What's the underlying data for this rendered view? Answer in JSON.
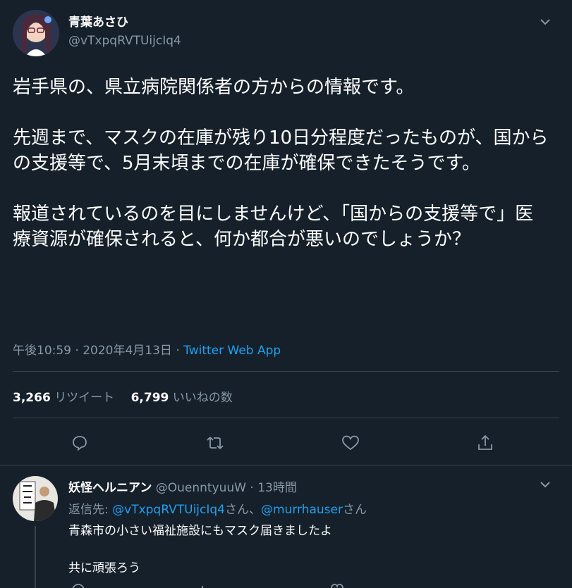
{
  "main_tweet": {
    "author_name": "青葉あさひ",
    "author_handle": "@vTxpqRVTUijcIq4",
    "avatar_icon": "user-avatar-anime-girl",
    "text": "岩手県の、県立病院関係者の方からの情報です。\n\n先週まで、マスクの在庫が残り10日分程度だったものが、国からの支援等で、5月末頃までの在庫が確保できたそうです。\n\n報道されているのを目にしませんけど、「国からの支援等で」医療資源が確保されると、何か都合が悪いのでしょうか？",
    "timestamp": "午後10:59 · 2020年4月13日 · ",
    "source": "Twitter Web App",
    "retweet_count": "3,266",
    "retweet_label": "リツイート",
    "like_count": "6,799",
    "like_label": "いいねの数"
  },
  "reply_tweet": {
    "author_name": "妖怪ヘルニアン",
    "author_handle": "@OuenntyuuW",
    "time_ago": "· 13時間",
    "reply_prefix": "返信先:",
    "reply_to_1": "@vTxpqRVTUijcIq4",
    "reply_sep_1": "さん、",
    "reply_to_2": "@murrhauser",
    "reply_sep_2": "さん",
    "line1": "青森市の小さい福祉施設にもマスク届きましたよ",
    "line2": "共に頑張ろう"
  },
  "colors": {
    "background": "#15202b",
    "accent": "#1da1f2",
    "muted": "#8899a6",
    "divider": "#38444d"
  }
}
